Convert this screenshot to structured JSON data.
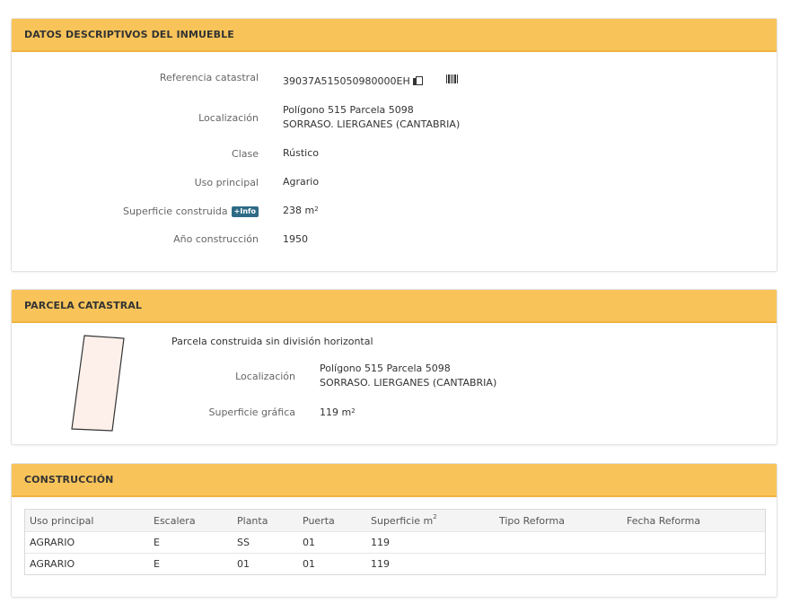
{
  "datos": {
    "title": "DATOS DESCRIPTIVOS DEL INMUEBLE",
    "ref_label": "Referencia catastral",
    "ref_value": "39037A515050980000EH",
    "loc_label": "Localización",
    "loc_line1": "Polígono 515 Parcela 5098",
    "loc_line2": "SORRASO. LIERGANES (CANTABRIA)",
    "clase_label": "Clase",
    "clase_value": "Rústico",
    "uso_label": "Uso principal",
    "uso_value": "Agrario",
    "sup_label": "Superficie construida",
    "info_badge": "+Info",
    "sup_value": "238 m",
    "sup_unit_exp": "2",
    "anio_label": "Año construcción",
    "anio_value": "1950"
  },
  "parcela": {
    "title": "PARCELA CATASTRAL",
    "subtitle": "Parcela construida sin división horizontal",
    "loc_label": "Localización",
    "loc_line1": "Polígono 515 Parcela 5098",
    "loc_line2": "SORRASO. LIERGANES (CANTABRIA)",
    "sup_label": "Superficie gráfica",
    "sup_value": "119 m",
    "sup_unit_exp": "2",
    "shape_fill": "#fdf0eb"
  },
  "construccion": {
    "title": "CONSTRUCCIÓN",
    "headers": [
      "Uso principal",
      "Escalera",
      "Planta",
      "Puerta",
      "Superficie m",
      "Tipo Reforma",
      "Fecha Reforma"
    ],
    "header_sup_exp": "2",
    "rows": [
      [
        "AGRARIO",
        "E",
        "SS",
        "01",
        "119",
        "",
        ""
      ],
      [
        "AGRARIO",
        "E",
        "01",
        "01",
        "119",
        "",
        ""
      ]
    ]
  },
  "colors": {
    "accent": "#f8c45a",
    "badge": "#2e6a86"
  }
}
